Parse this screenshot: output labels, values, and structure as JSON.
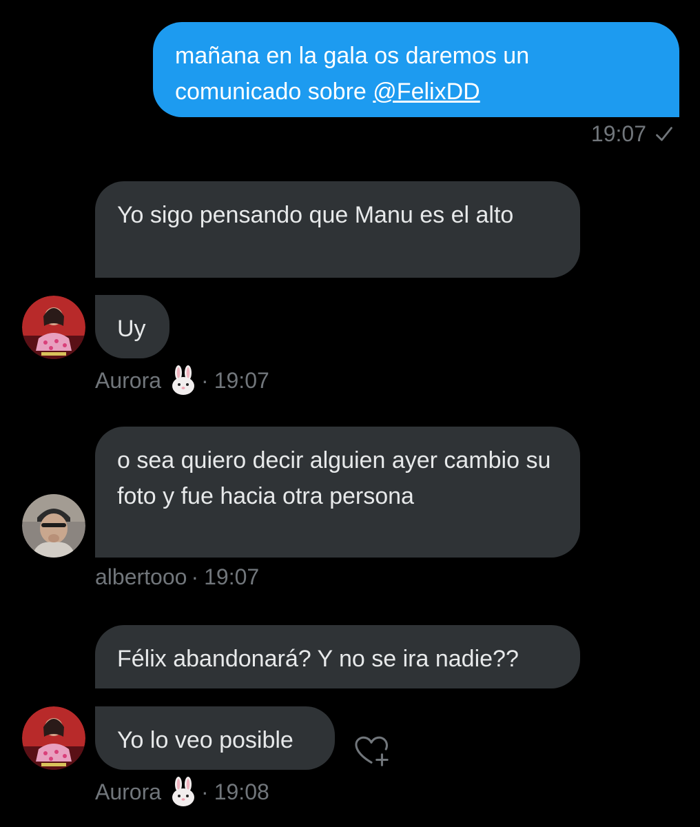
{
  "messages": {
    "m1": {
      "text": "mañana en la gala os daremos un comunicado sobre ",
      "mention": "@FelixDD",
      "time": "19:07"
    },
    "m2": {
      "text": "Yo sigo pensando que Manu es el alto"
    },
    "m3": {
      "text": "Uy",
      "sender": "Aurora",
      "time": "19:07"
    },
    "m4": {
      "text": "o sea quiero decir alguien ayer cambio su foto y fue hacia otra persona",
      "sender": "albertooo",
      "time": "19:07"
    },
    "m5": {
      "text": "Félix abandonará? Y no se ira nadie??"
    },
    "m6": {
      "text": "Yo lo veo posible",
      "sender": "Aurora",
      "time": "19:08"
    }
  },
  "separator": "·",
  "icons": {
    "read_receipt": "check-icon",
    "sender_emoji": "rabbit-face-icon",
    "reaction": "add-reaction-heart-icon"
  },
  "colors": {
    "background": "#000000",
    "outgoing_bubble": "#1d9bf0",
    "incoming_bubble": "#2f3336",
    "meta_text": "#71767b"
  }
}
